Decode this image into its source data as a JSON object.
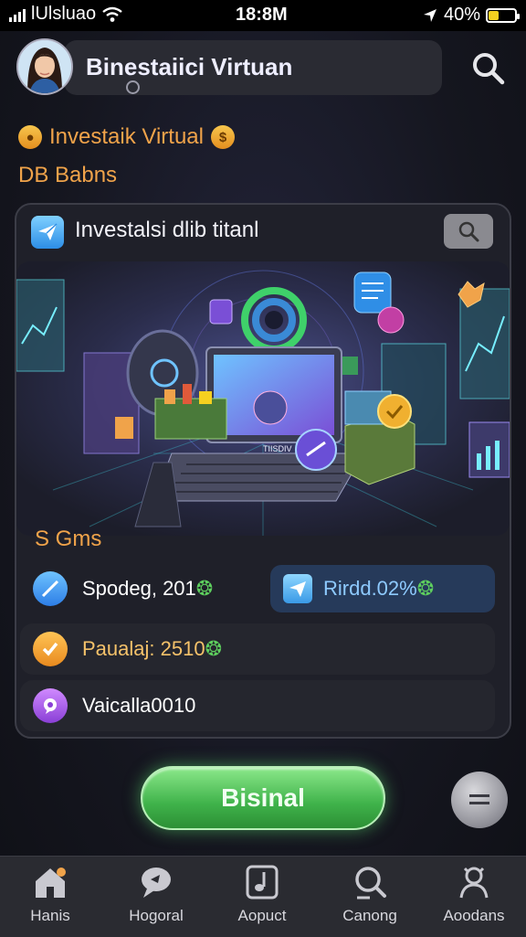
{
  "status": {
    "carrier": "lUlsluao",
    "time": "18:8M",
    "battery": "40%",
    "battery_level": 0.4
  },
  "header": {
    "title": "Binestaiici Virtuan"
  },
  "subtitle": {
    "line1": "Investaik Virtual",
    "line2": "DB Babns"
  },
  "card": {
    "title": "Investalsi dlib titanl",
    "screen_text": "TIISDIV",
    "section_label": "S Gms"
  },
  "rows": [
    {
      "label": "Spodeg, 201",
      "suffix": "❂"
    },
    {
      "label": "Rirdd.02%",
      "suffix": "❂"
    },
    {
      "label": "Paualaj: 2510",
      "suffix": "❂"
    },
    {
      "label": "Vaicalla0010",
      "suffix": ""
    }
  ],
  "cta": {
    "label": "Bisinal"
  },
  "tabs": [
    {
      "label": "Hanis",
      "icon": "home-icon"
    },
    {
      "label": "Hogoral",
      "icon": "chat-icon"
    },
    {
      "label": "Aopuct",
      "icon": "music-note-icon"
    },
    {
      "label": "Canong",
      "icon": "search-icon"
    },
    {
      "label": "Aoodans",
      "icon": "user-icon"
    }
  ],
  "colors": {
    "accent": "#f0a34a",
    "cta": "#3fb24a",
    "highlight_row": "#263a5a"
  }
}
